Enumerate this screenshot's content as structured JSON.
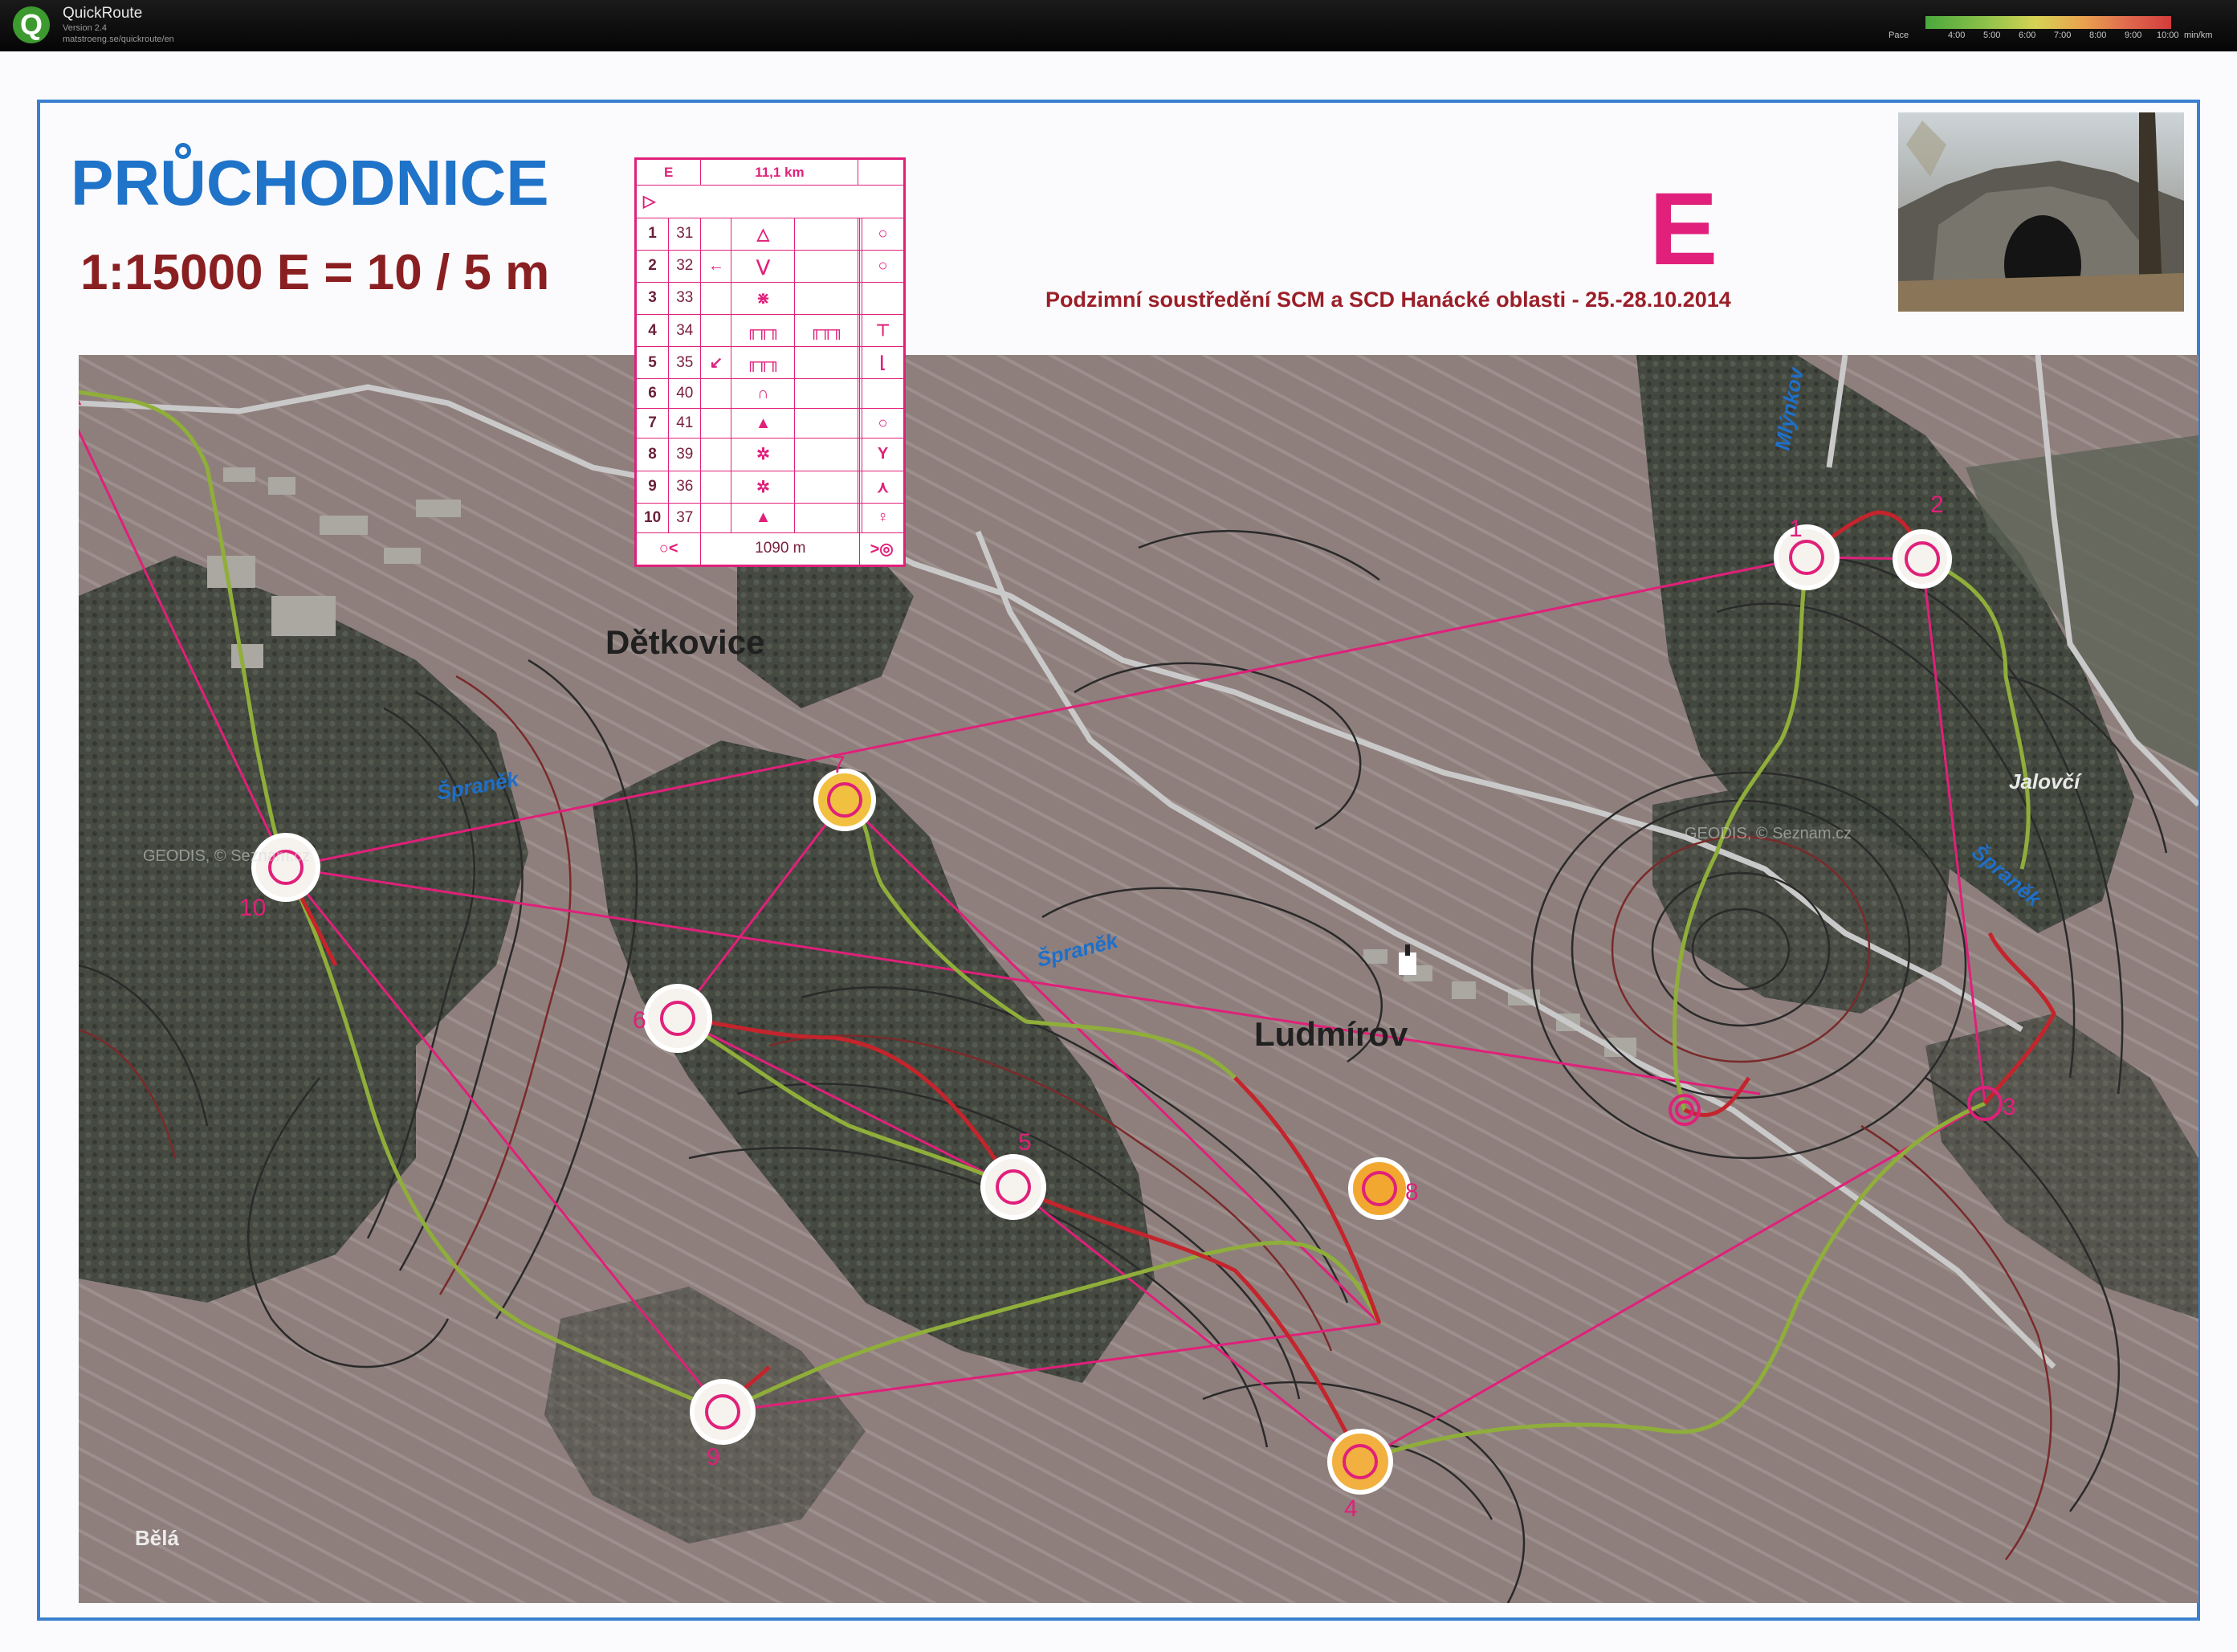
{
  "app": {
    "name": "QuickRoute",
    "version": "Version 2.4",
    "url": "matstroeng.se/quickroute/en",
    "pace_label": "Pace",
    "pace_ticks": [
      "4:00",
      "5:00",
      "6:00",
      "7:00",
      "8:00",
      "9:00",
      "10:00",
      "min/km"
    ]
  },
  "map": {
    "title": "PRŮCHODNICE",
    "scale": "1:15000  E = 10 / 5 m",
    "category": "E",
    "event": "Podzimní soustředění SCM a SCD Hanácké oblasti - 25.-28.10.2014",
    "colors": {
      "course": "#e0207a",
      "title": "#1f73c8",
      "scale": "#8a1f22",
      "frame": "#3a7fd0",
      "route_slow": "#c0202a",
      "route_fast": "#7aa23a"
    }
  },
  "descriptions": {
    "category": "E",
    "length": "11,1 km",
    "start_symbol": "triangle",
    "controls": [
      {
        "num": "1",
        "code": "31",
        "feature": "â",
        "detail": "ò"
      },
      {
        "num": "2",
        "code": "32",
        "feature": "⋁",
        "arrow": "←",
        "detail": "ò"
      },
      {
        "num": "3",
        "code": "33",
        "feature": "⚹",
        "detail": ""
      },
      {
        "num": "4",
        "code": "34",
        "feature": "ᚖ",
        "extra": "ᚖ",
        "detail": "ǒ"
      },
      {
        "num": "5",
        "code": "35",
        "feature": "ᚖ",
        "arrow": "↙",
        "detail": "ᴌ"
      },
      {
        "num": "6",
        "code": "40",
        "feature": "ᘉ",
        "detail": "ó"
      },
      {
        "num": "7",
        "code": "41",
        "feature": "▲",
        "detail": "ó"
      },
      {
        "num": "8",
        "code": "39",
        "feature": "※",
        "detail": "Y"
      },
      {
        "num": "9",
        "code": "36",
        "feature": "※",
        "detail": "⋏"
      },
      {
        "num": "10",
        "code": "37",
        "feature": "▲",
        "detail": "♀"
      }
    ],
    "finish_distance": "1090 m"
  },
  "labels": {
    "towns": [
      "Dětkovice",
      "Ludmírov"
    ],
    "streams": [
      "Špraněk",
      "Špraněk",
      "Špraněk",
      "Jalovčí",
      "Mlýnkov"
    ],
    "small": [
      "Bělá"
    ],
    "watermark": "GEODIS, © Seznam.cz"
  },
  "controls": [
    {
      "label": "1"
    },
    {
      "label": "2"
    },
    {
      "label": "3"
    },
    {
      "label": "4"
    },
    {
      "label": "5"
    },
    {
      "label": "6"
    },
    {
      "label": "7"
    },
    {
      "label": "8"
    },
    {
      "label": "9"
    },
    {
      "label": "10"
    }
  ]
}
